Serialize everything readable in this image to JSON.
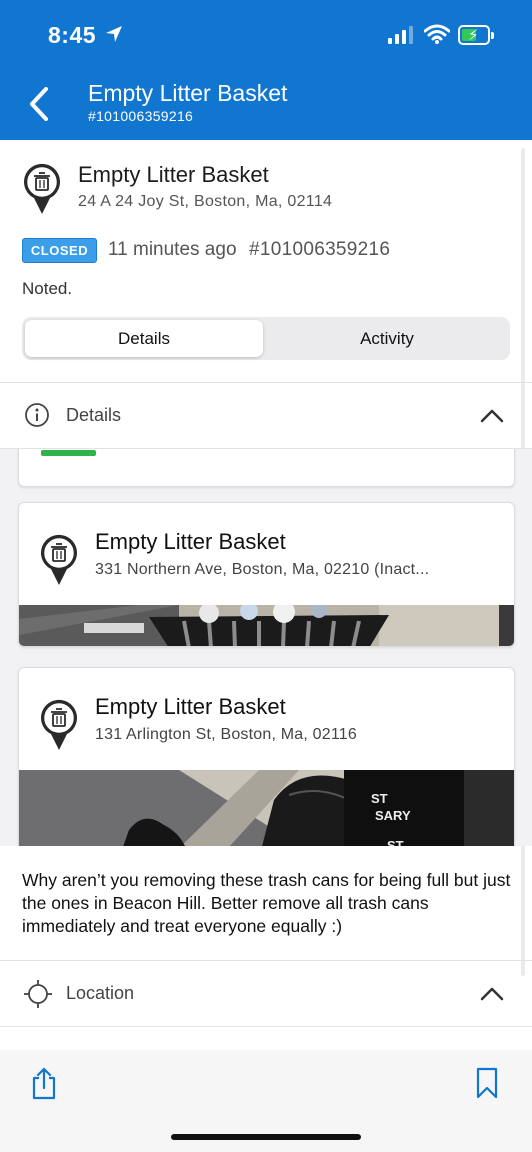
{
  "status_bar": {
    "time": "8:45"
  },
  "header": {
    "title": "Empty Litter Basket",
    "subtitle": "#101006359216"
  },
  "request": {
    "title": "Empty Litter Basket",
    "address": "24 A 24 Joy St, Boston, Ma, 02114",
    "status": "CLOSED",
    "age": "11 minutes ago",
    "id": "#101006359216",
    "note": "Noted."
  },
  "tabs": {
    "details": "Details",
    "activity": "Activity"
  },
  "details_section": {
    "label": "Details"
  },
  "related": [
    {
      "title": "Empty Litter Basket",
      "address": "331 Northern Ave, Boston, Ma, 02210 (Inact..."
    },
    {
      "title": "Empty Litter Basket",
      "address": "131 Arlington St, Boston, Ma, 02116",
      "photo_text": [
        "ST",
        "SARY",
        "ST"
      ]
    }
  ],
  "comment": "Why aren’t you removing these trash cans for being full but just the ones in Beacon Hill. Better remove all trash cans immediately and treat everyone equally :)",
  "location_section": {
    "label": "Location"
  },
  "colors": {
    "header_bg": "#1176d0",
    "badge_bg": "#3a9ee8",
    "battery_green": "#34c759"
  },
  "icons": [
    "location-arrow-icon",
    "signal-icon",
    "wifi-icon",
    "battery-icon",
    "back-chevron-icon",
    "trash-pin-icon",
    "info-icon",
    "chevron-up-icon",
    "crosshair-icon",
    "share-icon",
    "bookmark-icon"
  ]
}
